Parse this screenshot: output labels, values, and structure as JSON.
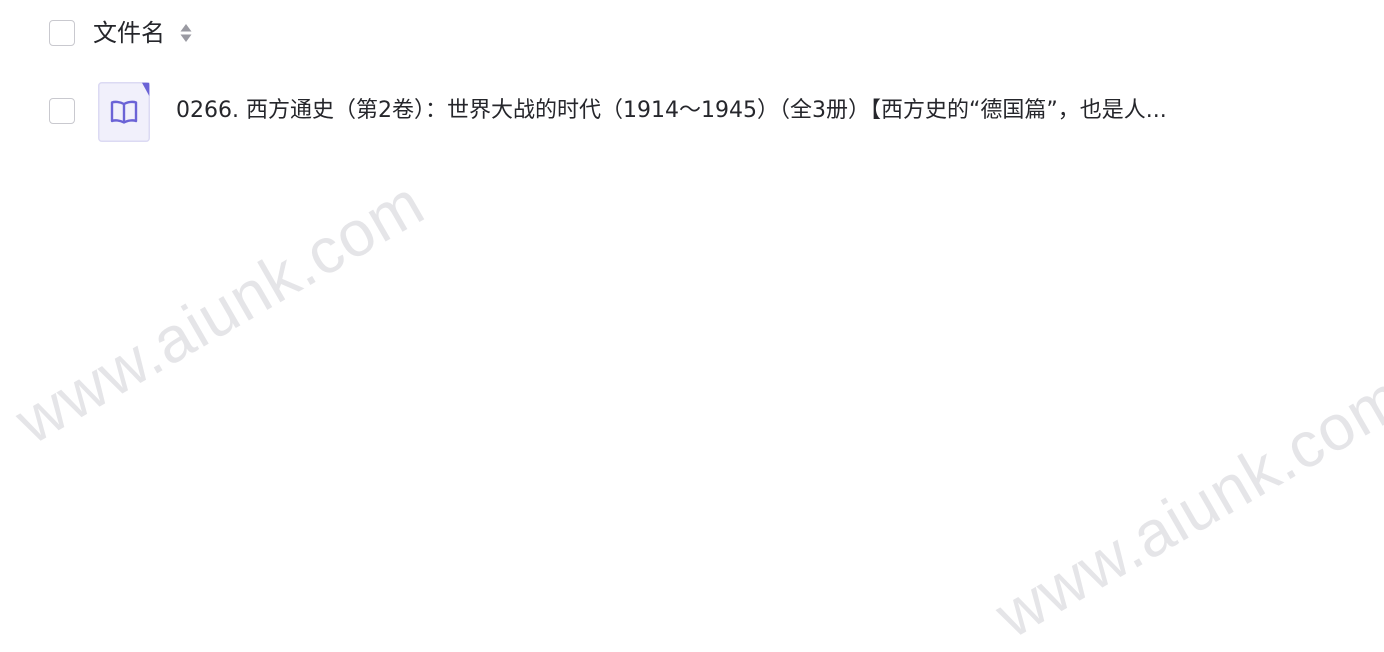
{
  "header": {
    "select_all_label": "",
    "column_title": "文件名",
    "sort_icon": "sort-up-down-icon"
  },
  "files": [
    {
      "icon": "book-icon",
      "name": "0266. 西方通史（第2卷）：世界大战的时代（1914～1945）（全3册）【西方史的“德国篇”，也是人..."
    }
  ],
  "watermark": {
    "text": "www.aiunk.com"
  },
  "colors": {
    "text": "#25262b",
    "checkbox_border": "#c9c9cf",
    "icon_accent": "#6b63d6",
    "icon_background": "#f1f0fb",
    "sort_icon": "#9a9aa2",
    "watermark": "#afafb6"
  }
}
